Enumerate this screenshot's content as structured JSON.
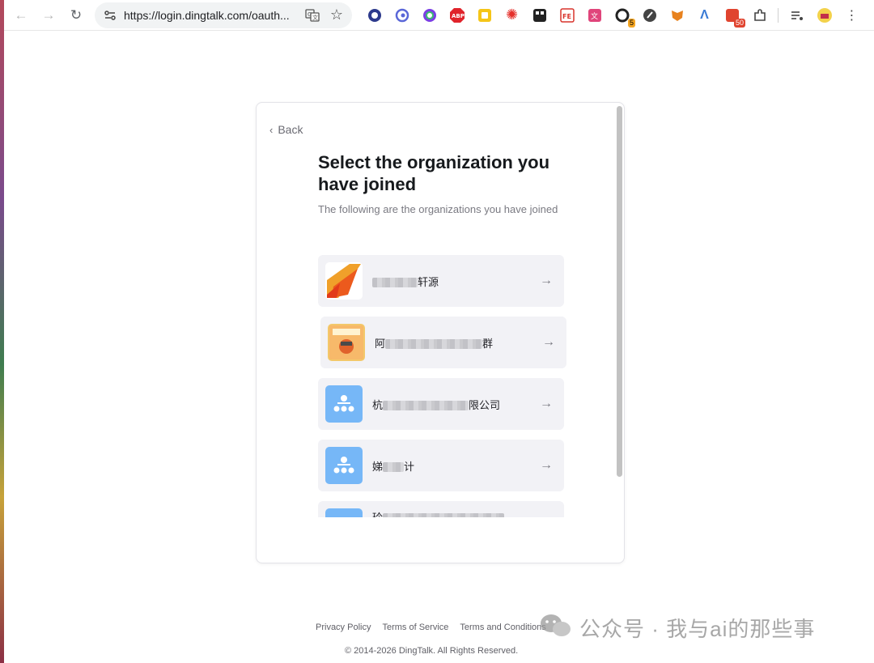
{
  "browser": {
    "url": "https://login.dingtalk.com/oauth...",
    "extensions": [
      {
        "icon": "ext-globe-icon",
        "color": "#2d3a8c"
      },
      {
        "icon": "ext-circle-icon",
        "color": "#5a67d8"
      },
      {
        "icon": "ext-chrome-icon",
        "color": "#7b3fe4"
      },
      {
        "icon": "adblock-icon",
        "label": "ABP",
        "color": "#e0232b"
      },
      {
        "icon": "ext-note-icon",
        "color": "#f5c518"
      },
      {
        "icon": "ext-sparkle-icon",
        "color": "#e5302b"
      },
      {
        "icon": "ext-grid-icon",
        "color": "#222222"
      },
      {
        "icon": "ext-fe-icon",
        "label": "FE",
        "color": "#d8342c"
      },
      {
        "icon": "ext-translate-icon",
        "color": "#e0457b"
      },
      {
        "icon": "ext-c-icon",
        "badge": "5",
        "color": "#222222"
      },
      {
        "icon": "ext-check-icon",
        "color": "#444444"
      },
      {
        "icon": "metamask-fox-icon",
        "color": "#e8821e"
      },
      {
        "icon": "ext-a-icon",
        "color": "#3a7bd5"
      },
      {
        "icon": "ext-badge-icon",
        "badge": "50",
        "color": "#e0442f"
      },
      {
        "icon": "extensions-puzzle-icon",
        "color": "#444444"
      }
    ]
  },
  "card": {
    "back_label": "Back",
    "title": "Select the organization you have joined",
    "subtitle": "The following are the organizations you have joined"
  },
  "organizations": [
    {
      "prefix": "",
      "suffix": "轩源",
      "avatar": "orange-logo"
    },
    {
      "prefix": "阿",
      "suffix": "群",
      "avatar": "poster"
    },
    {
      "prefix": "杭",
      "suffix": "限公司",
      "avatar": "org-tree"
    },
    {
      "prefix": "娣",
      "suffix": "计",
      "avatar": "org-tree"
    },
    {
      "prefix": "玲",
      "suffix": "...",
      "avatar": "org-tree"
    }
  ],
  "footer": {
    "privacy": "Privacy Policy",
    "terms_service": "Terms of Service",
    "terms_conditions": "Terms and Conditions",
    "copyright": "© 2014-2026 DingTalk. All Rights Reserved."
  },
  "watermark": {
    "text": "公众号 · 我与ai的那些事"
  },
  "colors": {
    "accent_blue": "#76b7f7",
    "item_bg": "#f2f2f6",
    "title": "#171a1d"
  }
}
